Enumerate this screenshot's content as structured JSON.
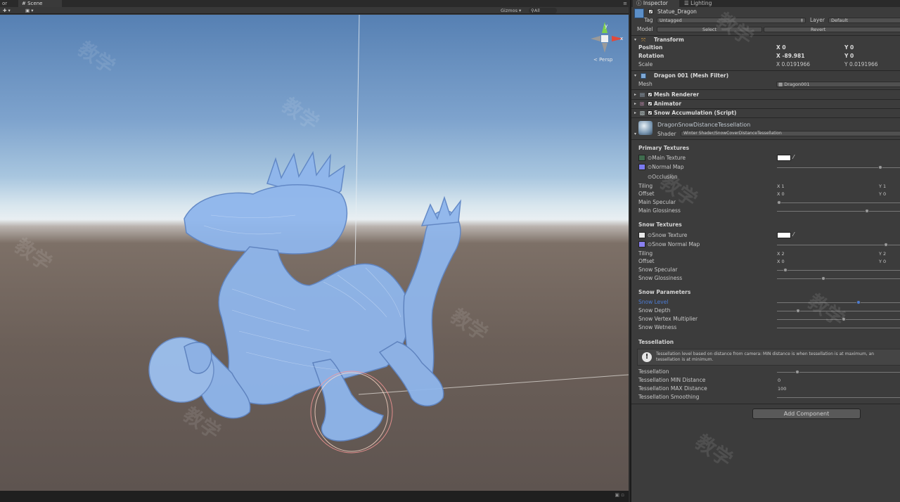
{
  "scene": {
    "tab_partial": "or",
    "tab_label": "Scene",
    "gizmos_label": "Gizmos",
    "search_placeholder": "All",
    "persp_label": "< Persp"
  },
  "inspector": {
    "tabs": [
      "Inspector",
      "Lighting"
    ],
    "object_name": "Statue_Dragon",
    "tag_label": "Tag",
    "tag_value": "Untagged",
    "layer_label": "Layer",
    "layer_value": "Default",
    "model_label": "Model",
    "select_label": "Select",
    "revert_label": "Revert",
    "transform": {
      "title": "Transform",
      "position_label": "Position",
      "rotation_label": "Rotation",
      "scale_label": "Scale",
      "position": {
        "x": "X  0",
        "y": "Y  0"
      },
      "rotation": {
        "x": "X  -89.981",
        "y": "Y  0"
      },
      "scale": {
        "x": "X  0.0191966",
        "y": "Y  0.0191966"
      }
    },
    "mesh_filter": {
      "title": "Dragon 001 (Mesh Filter)",
      "mesh_label": "Mesh",
      "mesh_value": "Dragon001"
    },
    "components": [
      "Mesh Renderer",
      "Animator",
      "Snow Accumulation (Script)"
    ],
    "material": {
      "name": "DragonSnowDistanceTessellation",
      "shader_label": "Shader",
      "shader_value": "Winter Shader/SnowCoverDistanceTessellation"
    },
    "primary_textures": {
      "title": "Primary Textures",
      "main_texture": "Main Texture",
      "normal_map": "Normal Map",
      "occlusion": "Occlusion",
      "tiling_label": "Tiling",
      "offset_label": "Offset",
      "tiling": {
        "x": "X  1",
        "y": "Y  1"
      },
      "offset": {
        "x": "X  0",
        "y": "Y  0"
      },
      "specular_label": "Main Specular",
      "glossiness_label": "Main Glossiness",
      "specular_value": 0.0,
      "glossiness_value": 0.73
    },
    "snow_textures": {
      "title": "Snow Textures",
      "snow_texture": "Snow Texture",
      "snow_normal_map": "Snow Normal Map",
      "tiling_label": "Tiling",
      "offset_label": "Offset",
      "tiling": {
        "x": "X  2",
        "y": "Y  2"
      },
      "offset": {
        "x": "X  0",
        "y": "Y  0"
      },
      "specular_label": "Snow Specular",
      "glossiness_label": "Snow Glossiness",
      "specular_value": 0.05,
      "glossiness_value": 0.37
    },
    "snow_parameters": {
      "title": "Snow Parameters",
      "snow_level": "Snow Level",
      "snow_depth": "Snow Depth",
      "vertex_multiplier": "Snow Vertex Multiplier",
      "wetness": "Snow Wetness",
      "snow_level_value": 0.66,
      "snow_depth_value": 0.16,
      "vertex_multiplier_value": 0.54
    },
    "tessellation": {
      "title": "Tessellation",
      "help_text_line1": "Tessellation level based on distance from camera: MIN distance is when tessellation is at maximum, an",
      "help_text_line2": "tessellation is at minimum.",
      "tessellation_label": "Tessellation",
      "min_label": "Tessellation MIN Distance",
      "max_label": "Tessellation MAX Distance",
      "smoothing_label": "Tessellation Smoothing",
      "min_value": "0",
      "max_value": "100",
      "tessellation_value": 0.15
    },
    "add_component": "Add Component"
  },
  "colors": {
    "panel_bg": "#3c3c3c",
    "highlight_blue": "#4d7cd4",
    "dragon_blue": "#8fb6ec"
  }
}
